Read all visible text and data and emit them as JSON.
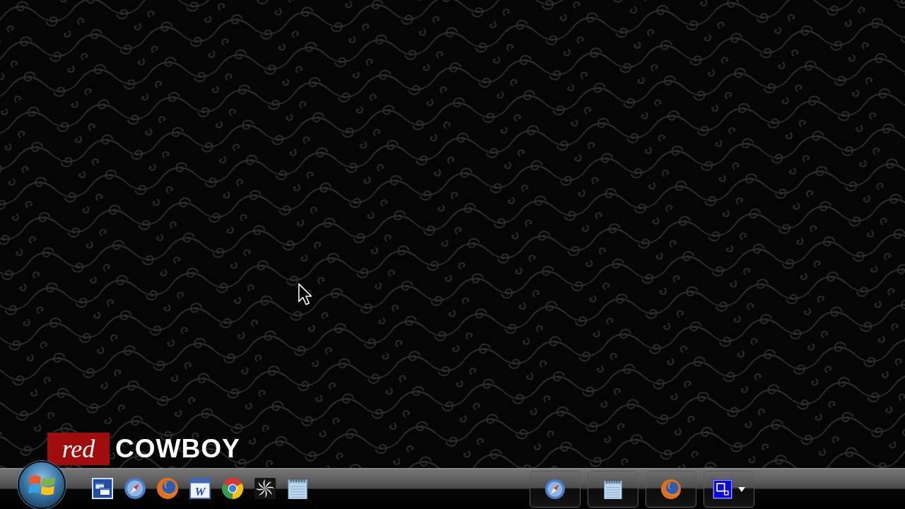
{
  "desktop": {
    "logo": {
      "script_word": "red",
      "word": "COWBOY"
    }
  },
  "taskbar": {
    "quick_launch": [
      {
        "kind": "window-switcher"
      },
      {
        "kind": "compass"
      },
      {
        "kind": "fox-globe"
      },
      {
        "kind": "document",
        "letter": "W"
      },
      {
        "kind": "segmented-ball"
      },
      {
        "kind": "pinwheel"
      },
      {
        "kind": "notepad"
      }
    ],
    "buttons": [
      {
        "kind": "compass",
        "menu": false
      },
      {
        "kind": "notepad",
        "menu": false
      },
      {
        "kind": "fox-globe",
        "menu": false
      },
      {
        "kind": "app-window",
        "menu": true
      }
    ]
  }
}
